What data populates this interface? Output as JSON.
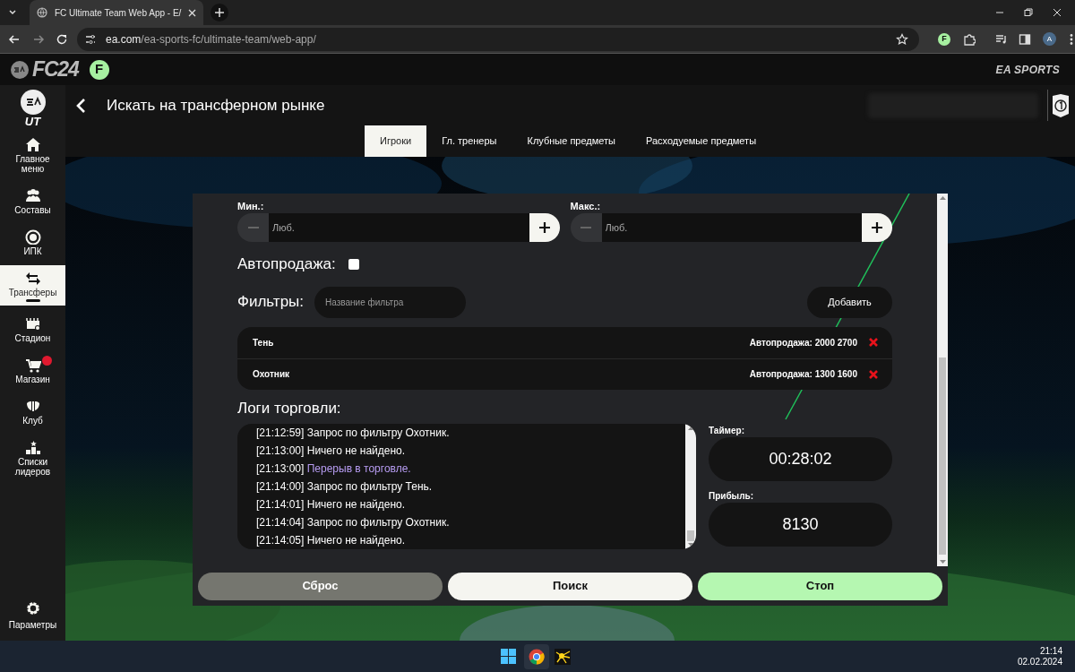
{
  "browser": {
    "tab_title": "FC Ultimate Team Web App - E/",
    "url_host": "ea.com",
    "url_path": "/ea-sports-fc/ultimate-team/web-app/",
    "extension_badge": "F",
    "profile": "A"
  },
  "site_header": {
    "logo": "FC24",
    "badge": "F",
    "brand": "EA SPORTS"
  },
  "sidebar": {
    "logo_text": "UT",
    "items": [
      {
        "label": "Главное меню",
        "selected": false,
        "notification": false
      },
      {
        "label": "Составы",
        "selected": false,
        "notification": false
      },
      {
        "label": "ИПК",
        "selected": false,
        "notification": false
      },
      {
        "label": "Трансферы",
        "selected": true,
        "notification": false
      },
      {
        "label": "Стадион",
        "selected": false,
        "notification": false
      },
      {
        "label": "Магазин",
        "selected": false,
        "notification": true
      },
      {
        "label": "Клуб",
        "selected": false,
        "notification": false
      },
      {
        "label": "Списки лидеров",
        "selected": false,
        "notification": false
      }
    ],
    "settings": "Параметры"
  },
  "page": {
    "title": "Искать на трансферном рынке",
    "tabs": [
      {
        "label": "Игроки",
        "selected": true
      },
      {
        "label": "Гл. тренеры",
        "selected": false
      },
      {
        "label": "Клубные предметы",
        "selected": false
      },
      {
        "label": "Расходуемые предметы",
        "selected": false
      }
    ]
  },
  "form": {
    "price_fields": [
      {
        "label": "Мин.:",
        "placeholder": "Люб."
      },
      {
        "label": "Макс.:",
        "placeholder": "Люб."
      }
    ],
    "autosell": {
      "label": "Автопродажа:",
      "checked": false
    },
    "filters": {
      "label": "Фильтры:",
      "placeholder": "Название фильтра",
      "add_button": "Добавить",
      "items": [
        {
          "name": "Тень",
          "autosell": "Автопродажа: 2000 2700"
        },
        {
          "name": "Охотник",
          "autosell": "Автопродажа: 1300 1600"
        }
      ]
    },
    "logs": {
      "title": "Логи торговли:",
      "entries": [
        {
          "time": "[21:12:59]",
          "message": "Запрос по фильтру Охотник.",
          "kind": "normal"
        },
        {
          "time": "[21:13:00]",
          "message": "Ничего не найдено.",
          "kind": "normal"
        },
        {
          "time": "[21:13:00]",
          "message": "Перерыв в торговле.",
          "kind": "highlight"
        },
        {
          "time": "[21:14:00]",
          "message": "Запрос по фильтру Тень.",
          "kind": "normal"
        },
        {
          "time": "[21:14:01]",
          "message": "Ничего не найдено.",
          "kind": "normal"
        },
        {
          "time": "[21:14:04]",
          "message": "Запрос по фильтру Охотник.",
          "kind": "normal"
        },
        {
          "time": "[21:14:05]",
          "message": "Ничего не найдено.",
          "kind": "normal"
        }
      ]
    },
    "stats": [
      {
        "label": "Таймер:",
        "value": "00:28:02"
      },
      {
        "label": "Прибыль:",
        "value": "8130"
      }
    ],
    "buttons": [
      {
        "label": "Сброс",
        "kind": "secondary"
      },
      {
        "label": "Поиск",
        "kind": "light"
      },
      {
        "label": "Стоп",
        "kind": "accent"
      }
    ]
  },
  "taskbar": {
    "time": "21:14",
    "date": "02.02.2024"
  }
}
